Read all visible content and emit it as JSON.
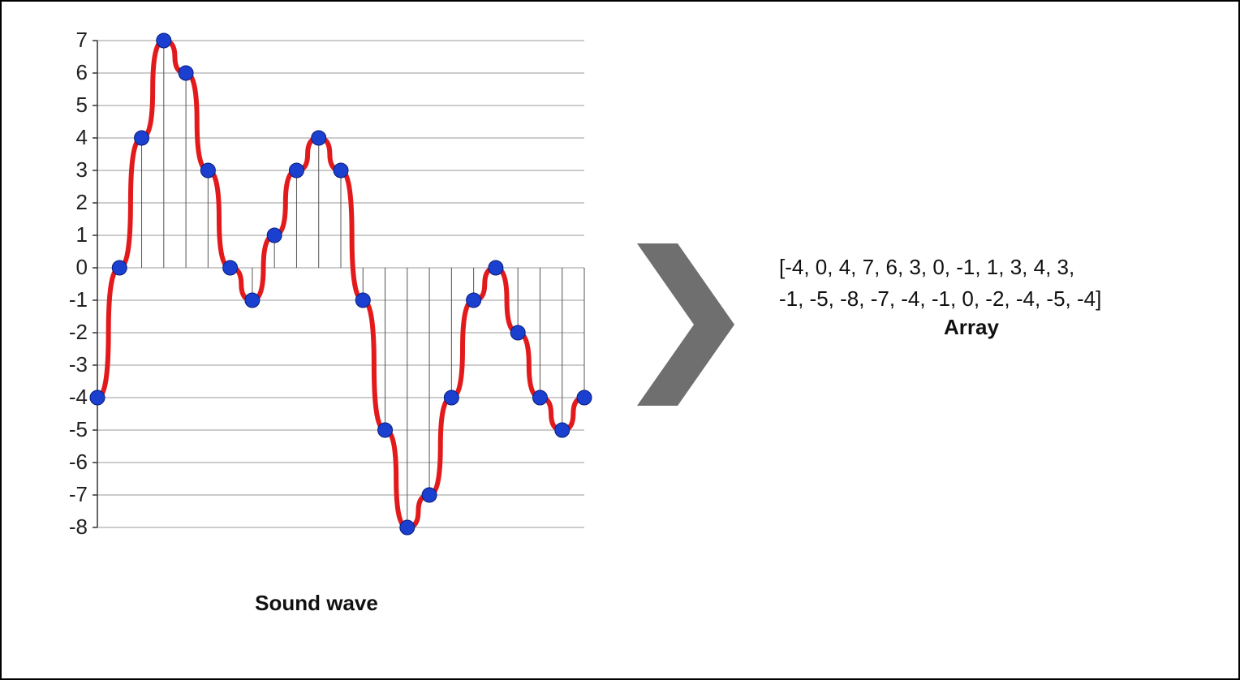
{
  "chart_data": {
    "type": "line",
    "x": [
      0,
      1,
      2,
      3,
      4,
      5,
      6,
      7,
      8,
      9,
      10,
      11,
      12,
      13,
      14,
      15,
      16,
      17,
      18,
      19,
      20,
      21
    ],
    "values": [
      -4,
      0,
      4,
      7,
      6,
      3,
      0,
      -1,
      1,
      3,
      4,
      3,
      -1,
      -5,
      -8,
      -7,
      -4,
      -1,
      0,
      -2,
      -4,
      -5,
      -4
    ],
    "ylim": [
      -8,
      7
    ],
    "yticks": [
      7,
      6,
      5,
      4,
      3,
      2,
      1,
      0,
      -1,
      -2,
      -3,
      -4,
      -5,
      -6,
      -7,
      -8
    ],
    "title": "",
    "xlabel": "Sound wave",
    "ylabel": "",
    "series_color": "#e31a1c",
    "point_color": "#1b3fcf"
  },
  "captions": {
    "left": "Sound wave",
    "right": "Array"
  },
  "array_display": "[-4, 0, 4, 7, 6, 3, 0, -1, 1, 3, 4, 3,\n-1, -5, -8, -7, -4, -1, 0, -2, -4, -5, -4]"
}
